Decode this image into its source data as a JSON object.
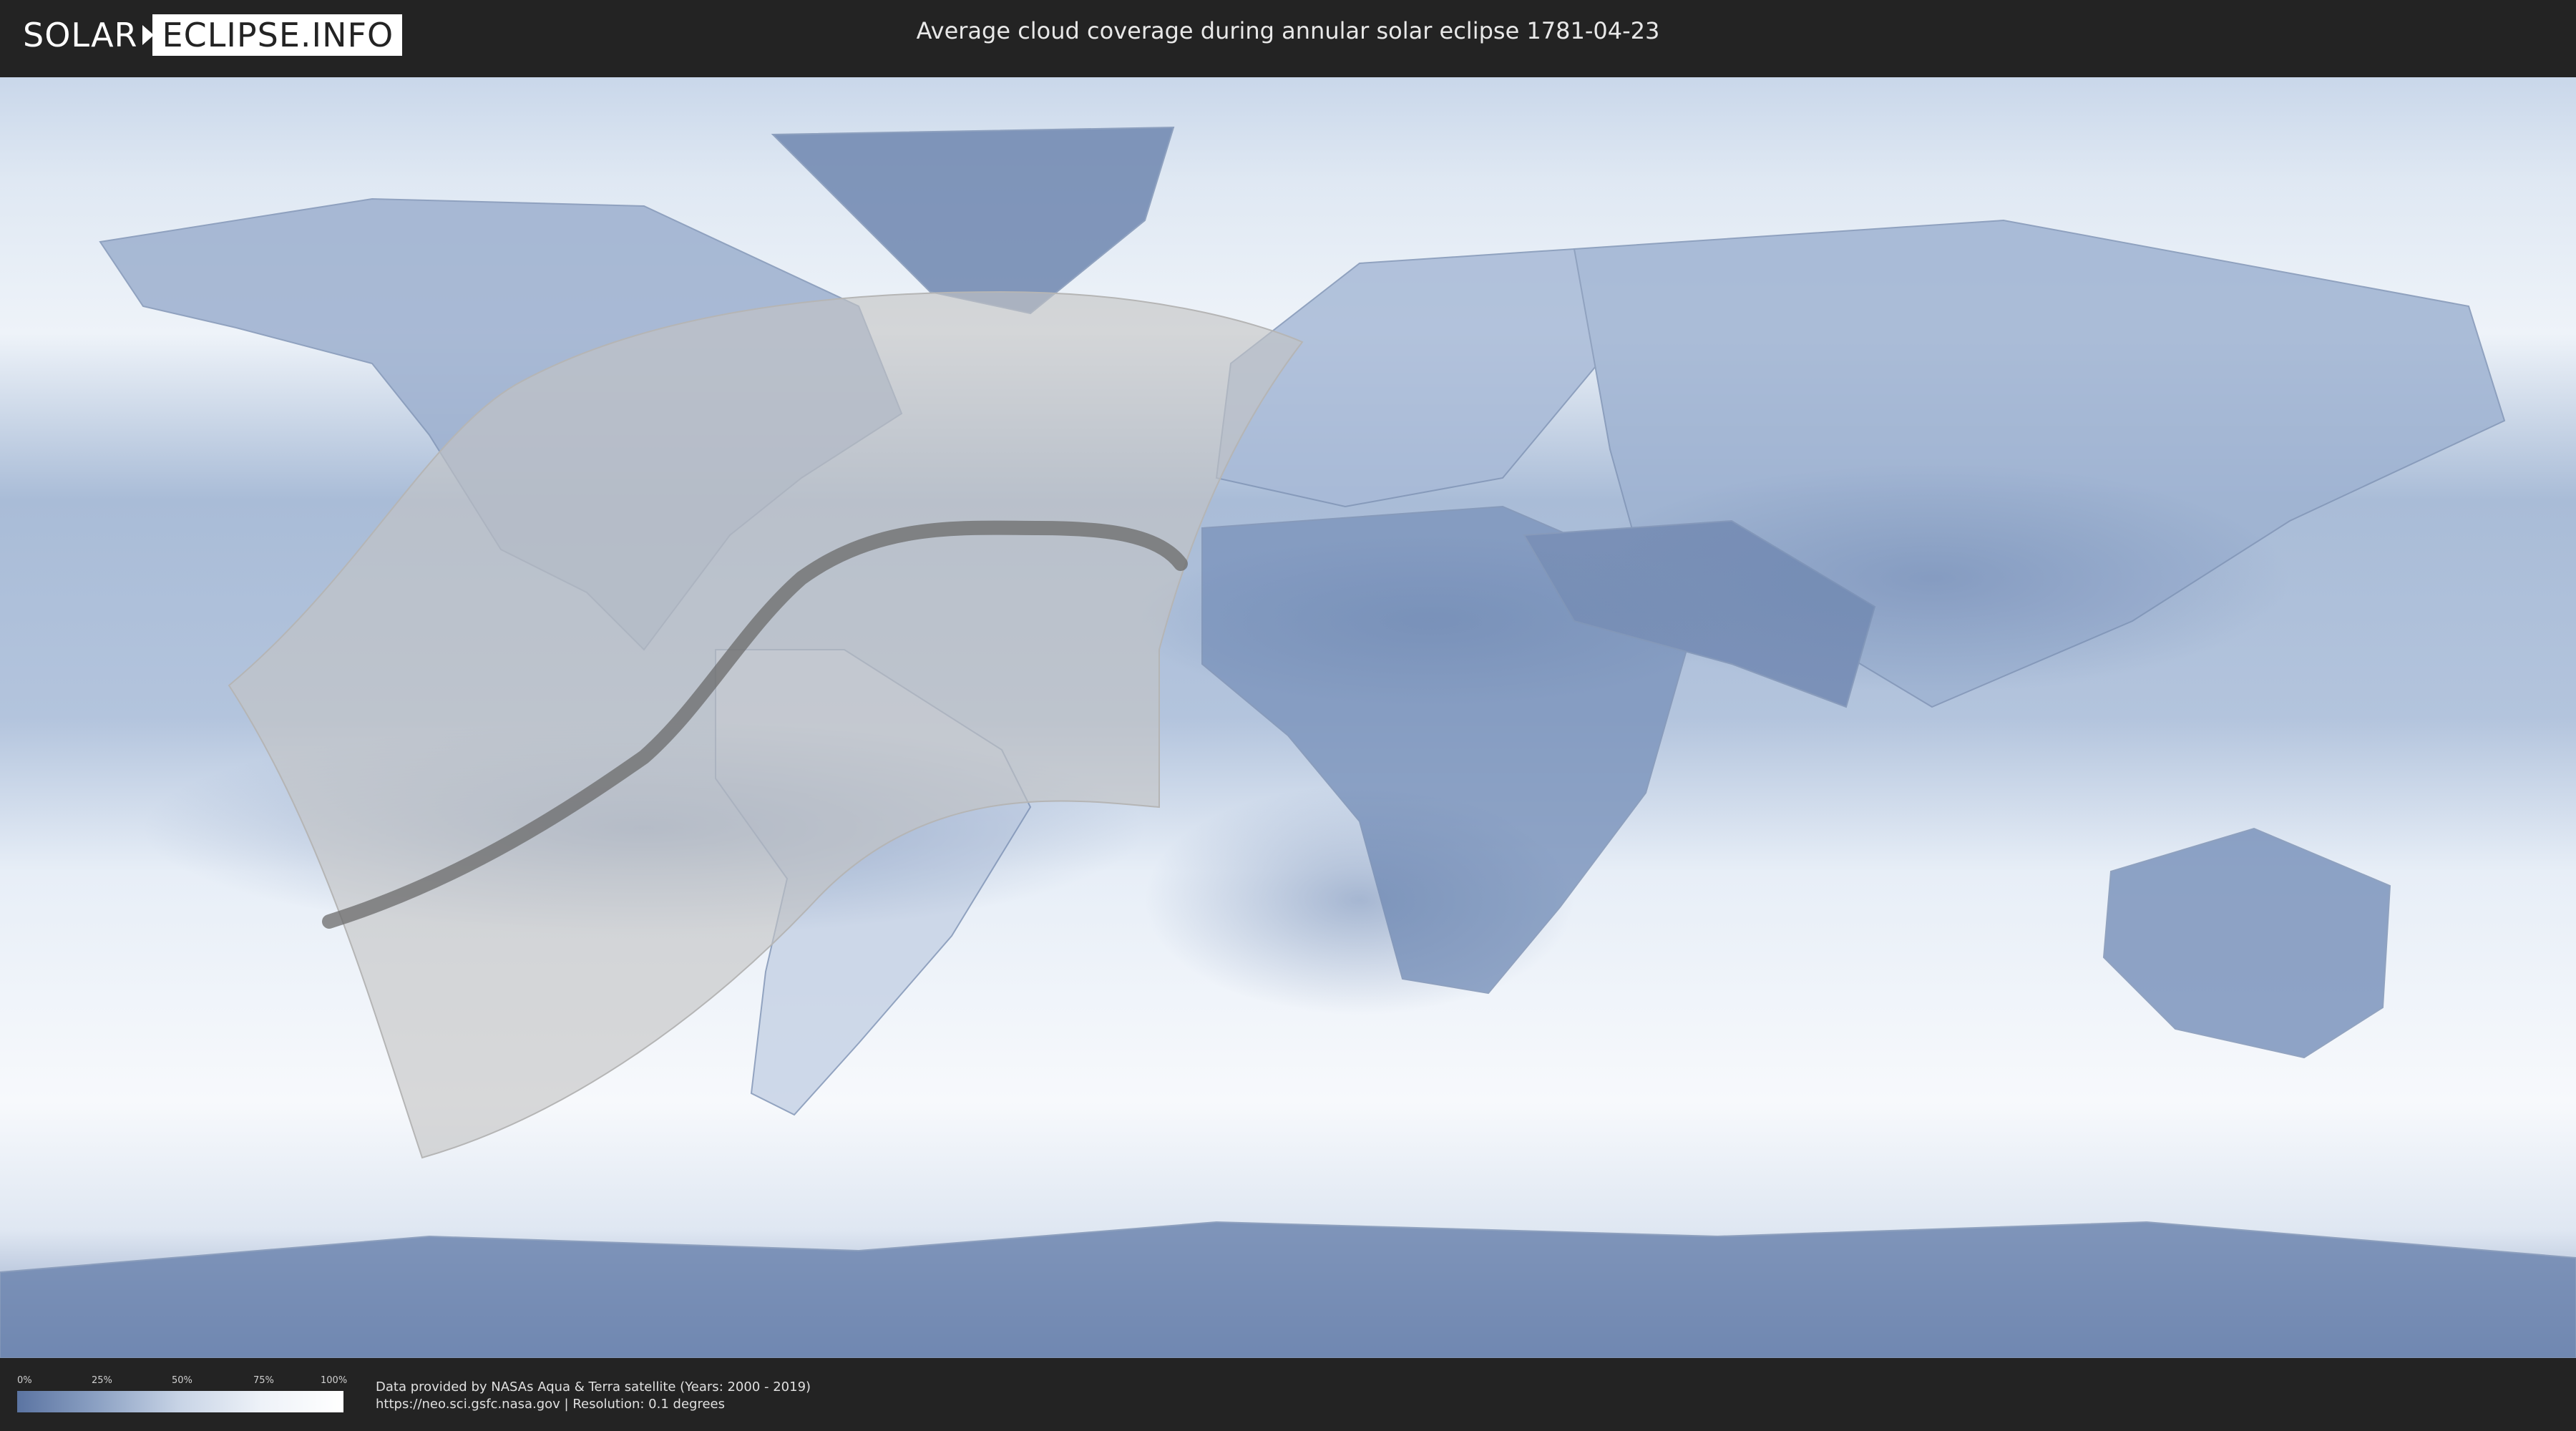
{
  "header": {
    "logo_left": "SOLAR",
    "logo_right": "ECLIPSE.INFO",
    "title": "Average cloud coverage during annular solar eclipse 1781-04-23"
  },
  "map": {
    "type": "equirectangular world cloud-coverage map",
    "color_scale": "blue (0%) to white (100%)",
    "ocean_land_base": "#dce6f2",
    "low_cloud_color": "#6a83ad",
    "high_cloud_color": "#ffffff",
    "eclipse_visibility_zone_color": "#c4c4c4",
    "central_path_color": "#6b6b6b"
  },
  "legend": {
    "ticks": [
      "0%",
      "25%",
      "50%",
      "75%",
      "100%"
    ],
    "colors": [
      "#5b74a2",
      "#8da2c4",
      "#c8d4e6",
      "#eef2f8",
      "#ffffff"
    ]
  },
  "footer": {
    "line1": "Data provided by NASAs Aqua & Terra satellite (Years: 2000 - 2019)",
    "line2": "https://neo.sci.gsfc.nasa.gov | Resolution: 0.1 degrees"
  }
}
